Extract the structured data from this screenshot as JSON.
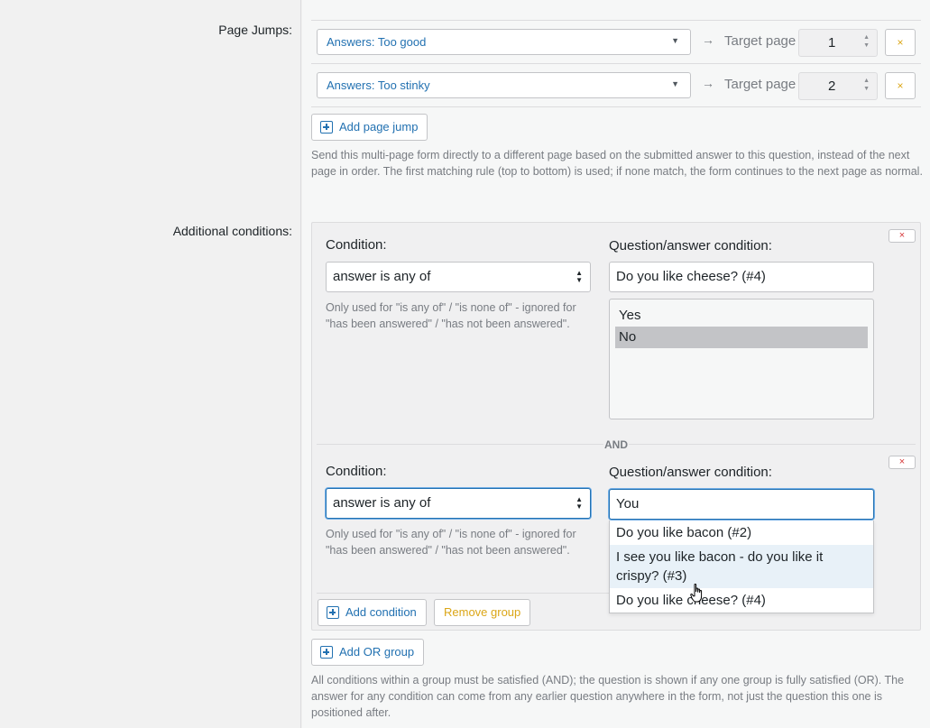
{
  "page_jumps": {
    "label": "Page Jumps:",
    "rows": [
      {
        "answer": "Answers: Too good",
        "arrow": "→",
        "target_label": "Target page",
        "target_value": "1",
        "remove": "×"
      },
      {
        "answer": "Answers: Too stinky",
        "arrow": "→",
        "target_label": "Target page",
        "target_value": "2",
        "remove": "×"
      }
    ],
    "add_button": "Add page jump",
    "description": "Send this multi-page form directly to a different page based on the submitted answer to this question, instead of the next page in order. The first matching rule (top to bottom) is used; if none match, the form continues to the next page as normal."
  },
  "conditions": {
    "label": "Additional conditions:",
    "group_remove": "×",
    "items": [
      {
        "condition_label": "Condition:",
        "condition_value": "answer is any of",
        "help": "Only used for \"is any of\" / \"is none of\" - ignored for \"has been answered\" / \"has not been answered\".",
        "qa_label": "Question/answer condition:",
        "qa_value": "Do you like cheese? (#4)",
        "answers": [
          "Yes",
          "No"
        ],
        "selected_answer": "No",
        "remove": "×"
      },
      {
        "condition_label": "Condition:",
        "condition_value": "answer is any of",
        "help": "Only used for \"is any of\" / \"is none of\" - ignored for \"has been answered\" / \"has not been answered\".",
        "qa_label": "Question/answer condition:",
        "qa_value": "You",
        "remove": "×"
      }
    ],
    "and_label": "AND",
    "autocomplete": [
      "Do you like bacon (#2)",
      "I see you like bacon - do you like it crispy? (#3)",
      "Do you like cheese? (#4)"
    ],
    "add_condition": "Add condition",
    "remove_group": "Remove group",
    "add_or_group": "Add OR group",
    "description": "All conditions within a group must be satisfied (AND); the question is shown if any one group is fully satisfied (OR). The answer for any condition can come from any earlier question anywhere in the form, not just the question this one is positioned after."
  },
  "colors": {
    "link_blue": "#2271b1",
    "warning_orange": "#dba617",
    "muted_text": "#787c82"
  },
  "icons": [
    "chevron-down-icon",
    "arrow-right-icon",
    "close-icon",
    "plus-square-icon",
    "updown-icon",
    "hand-cursor-icon"
  ]
}
